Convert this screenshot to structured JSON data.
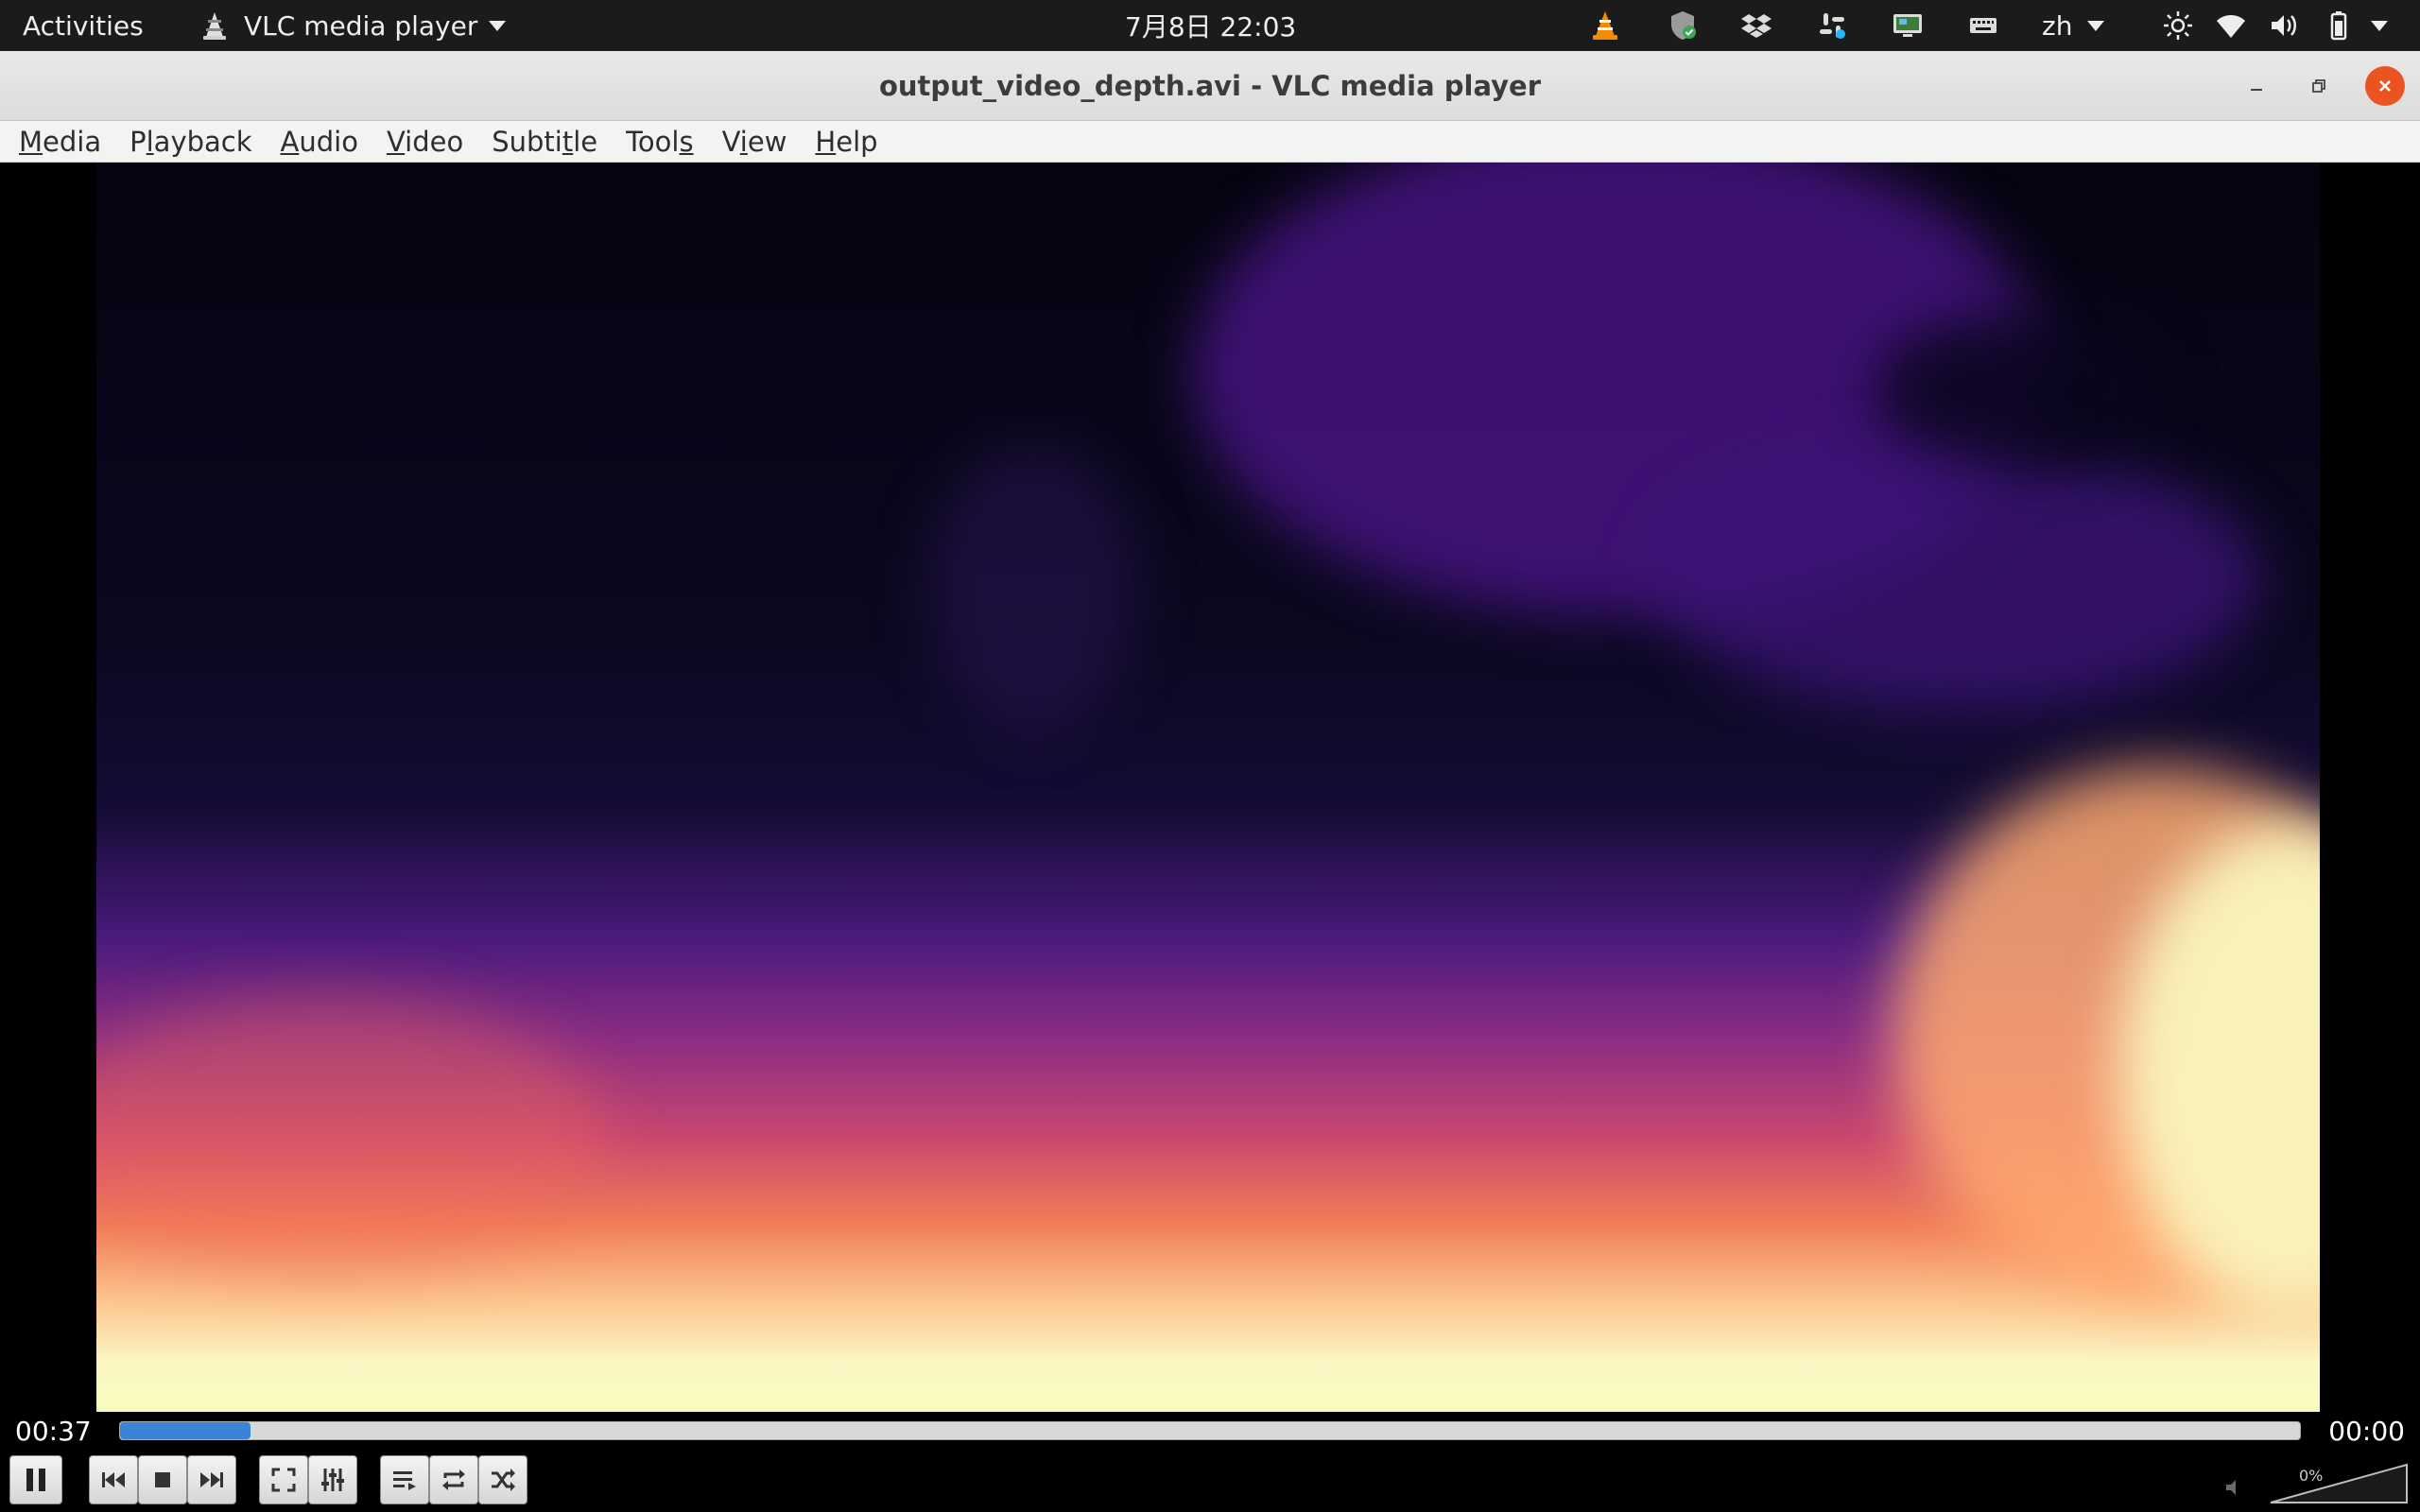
{
  "topbar": {
    "activities": "Activities",
    "app_name": "VLC media player",
    "clock": "7月8日  22:03",
    "lang": "zh"
  },
  "window": {
    "title": "output_video_depth.avi - VLC media player"
  },
  "menubar": {
    "items": [
      {
        "label": "Media",
        "mnemonic_index": 0
      },
      {
        "label": "Playback",
        "mnemonic_index": 1
      },
      {
        "label": "Audio",
        "mnemonic_index": 0
      },
      {
        "label": "Video",
        "mnemonic_index": 0
      },
      {
        "label": "Subtitle",
        "mnemonic_index": 5
      },
      {
        "label": "Tools",
        "mnemonic_index": 4
      },
      {
        "label": "View",
        "mnemonic_index": 1
      },
      {
        "label": "Help",
        "mnemonic_index": 0
      }
    ]
  },
  "player": {
    "elapsed": "00:37",
    "total": "00:00",
    "seek_fraction": 0.06,
    "volume_label": "0%",
    "volume_fraction": 0.0
  },
  "colors": {
    "seek_fill": "#3a84d6",
    "close_button": "#e95420",
    "topbar_bg": "#1b1b1b"
  },
  "icons": {
    "tray": [
      "vlc-tray-icon",
      "shield-icon",
      "dropbox-icon",
      "slack-icon",
      "screen-icon",
      "keyboard-icon"
    ],
    "system": [
      "brightness-icon",
      "wifi-icon",
      "volume-icon",
      "battery-icon"
    ]
  }
}
